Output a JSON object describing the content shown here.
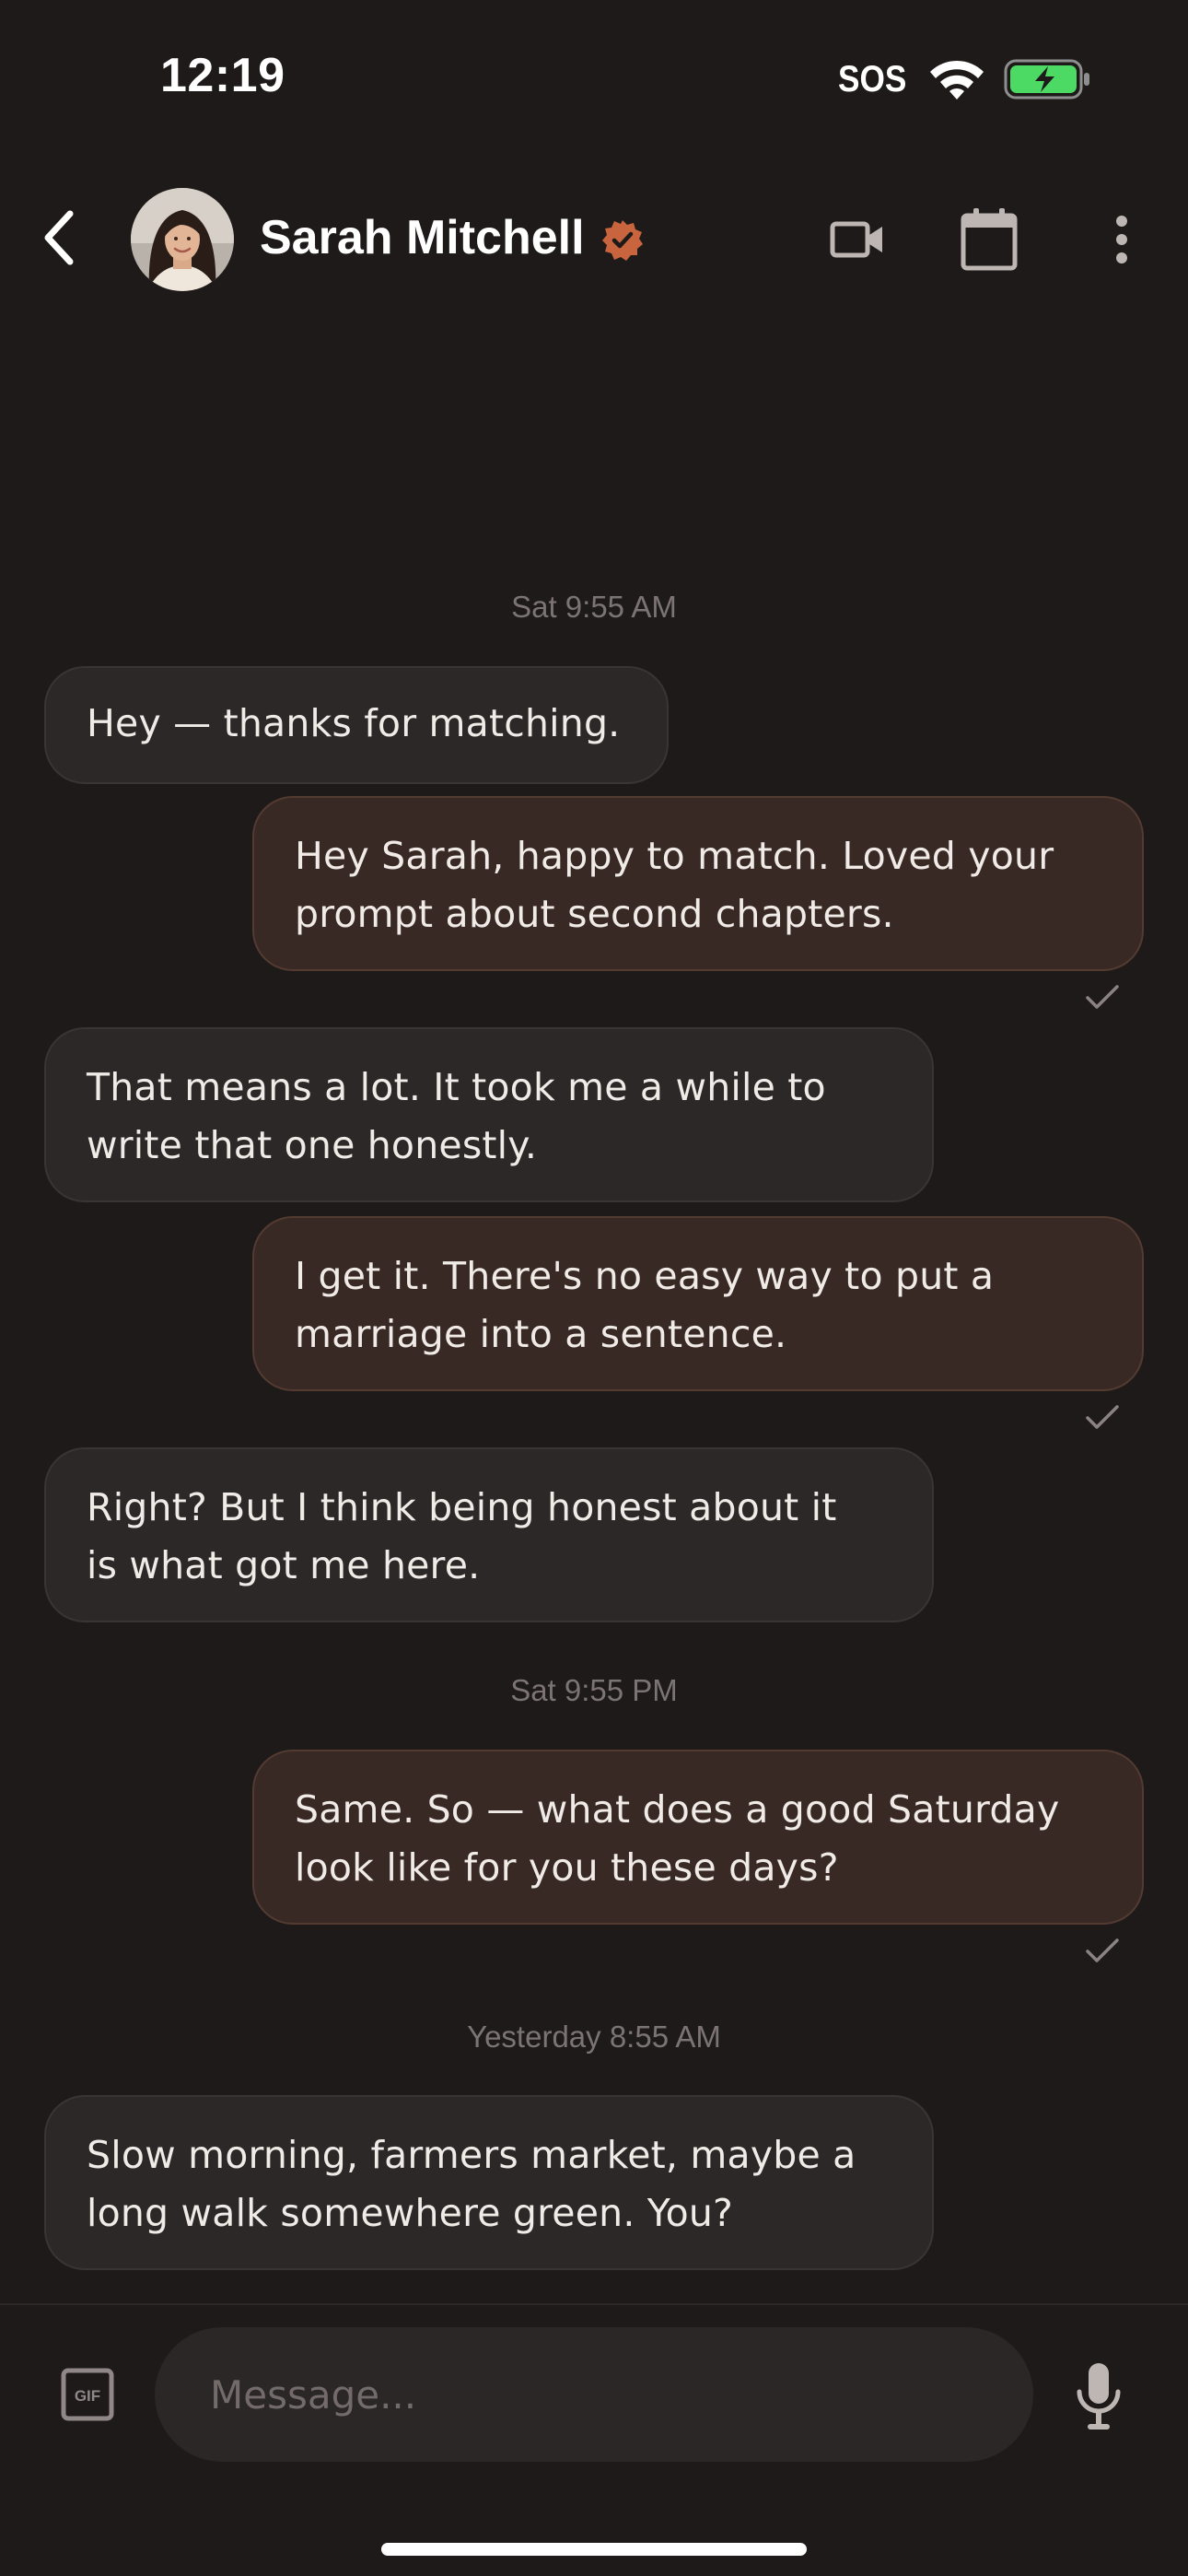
{
  "status_bar": {
    "time": "12:19",
    "carrier": "SOS",
    "wifi_icon": "wifi-icon",
    "battery_icon": "battery-charging-icon",
    "battery_color": "#4cd964"
  },
  "header": {
    "contact_name": "Sarah Mitchell",
    "verified_icon": "verified-badge-icon",
    "accent_color": "#c8653e",
    "actions": [
      "video-call-icon",
      "calendar-icon",
      "more-vertical-icon"
    ]
  },
  "messages": [
    {
      "type": "timestamp",
      "text": "Sat 9:55 AM"
    },
    {
      "type": "received",
      "lines": [
        "Hey — thanks for matching."
      ]
    },
    {
      "type": "sent",
      "lines": [
        "Hey Sarah, happy to match. Loved your",
        "prompt about second chapters."
      ],
      "status": "sent-check-icon"
    },
    {
      "type": "received",
      "lines": [
        "That means a lot. It took me a while to",
        "write that one honestly."
      ]
    },
    {
      "type": "sent",
      "lines": [
        "I get it. There's no easy way to put a",
        "marriage into a sentence."
      ],
      "status": "sent-check-icon"
    },
    {
      "type": "received",
      "lines": [
        "Right? But I think being honest about it",
        "is what got me here."
      ]
    },
    {
      "type": "timestamp",
      "text": "Sat 9:55 PM"
    },
    {
      "type": "sent",
      "lines": [
        "Same. So — what does a good Saturday",
        "look like for you these days?"
      ],
      "status": "sent-check-icon"
    },
    {
      "type": "timestamp",
      "text": "Yesterday 8:55 AM"
    },
    {
      "type": "received",
      "lines": [
        "Slow morning, farmers market, maybe a",
        "long walk somewhere green. You?"
      ]
    }
  ],
  "composer": {
    "placeholder": "Message...",
    "gif_icon": "gif-icon",
    "mic_icon": "microphone-icon"
  },
  "colors": {
    "background": "#1d1a19",
    "received_bubble": "#2b2827",
    "sent_bubble": "#382925"
  }
}
